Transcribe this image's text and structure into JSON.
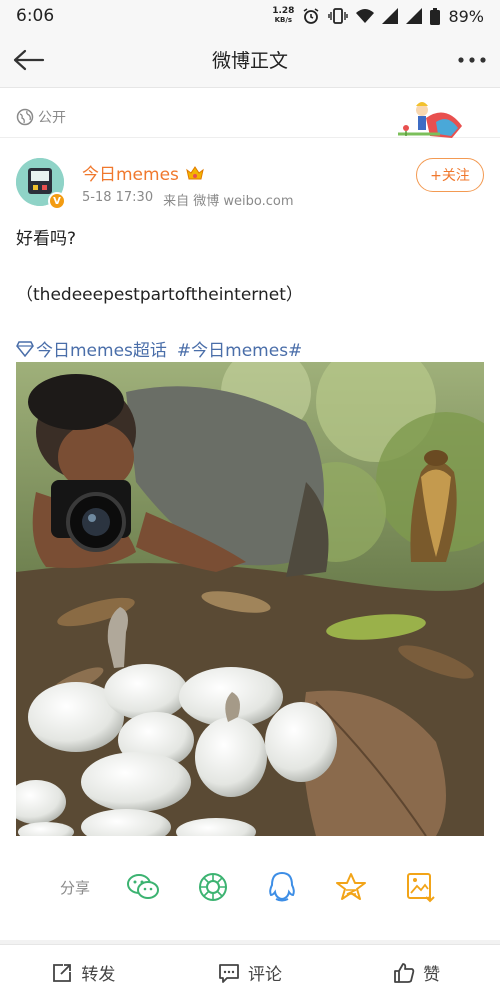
{
  "status_bar": {
    "time": "6:06",
    "net_speed": "1.28",
    "net_unit": "KB/s",
    "battery": "89%"
  },
  "title_bar": {
    "title": "微博正文"
  },
  "visibility": {
    "label": "公开"
  },
  "author": {
    "name": "今日memes",
    "time": "5-18 17:30",
    "source": "来自 微博 weibo.com",
    "follow_label": "+关注"
  },
  "post": {
    "text": "好看吗?",
    "credit": "（thedeeepestpartoftheinternet）",
    "topics": [
      "今日memes超话",
      "#今日memes#"
    ]
  },
  "share": {
    "label": "分享",
    "icons": [
      "wechat-icon",
      "moments-icon",
      "qq-icon",
      "qzone-icon",
      "save-image-icon"
    ]
  },
  "actions": {
    "repost": "转发",
    "comment": "评论",
    "like": "赞"
  },
  "colors": {
    "accent": "#f0782d",
    "link": "#4a6ea9",
    "share_green": "#3cb371",
    "share_blue": "#3d8ee6",
    "share_gold": "#f2a418"
  }
}
